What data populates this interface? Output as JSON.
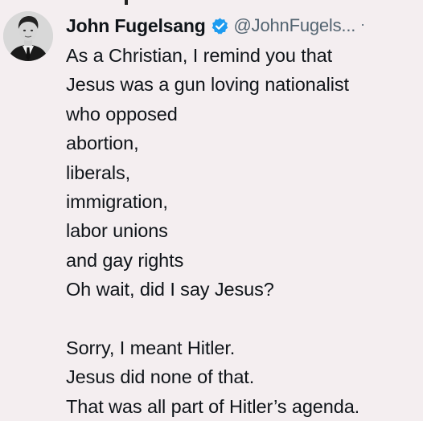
{
  "tweet": {
    "author": {
      "display_name": "John Fugelsang",
      "handle": "@JohnFugels...",
      "more": "·",
      "verified_icon": "verified-badge-icon",
      "verified_color": "#1d9bf0"
    },
    "lines": [
      "As a Christian, I remind you that",
      "Jesus was a gun loving nationalist",
      "who opposed",
      "abortion,",
      "liberals,",
      "immigration,",
      "labor unions",
      "and gay rights",
      "Oh wait, did I say Jesus?",
      "",
      "Sorry, I meant Hitler.",
      "Jesus did none of that.",
      "That was all part of Hitler’s agenda."
    ]
  },
  "colors": {
    "background": "#f4eef0",
    "text": "#0f1419",
    "secondary_text": "#536471"
  }
}
